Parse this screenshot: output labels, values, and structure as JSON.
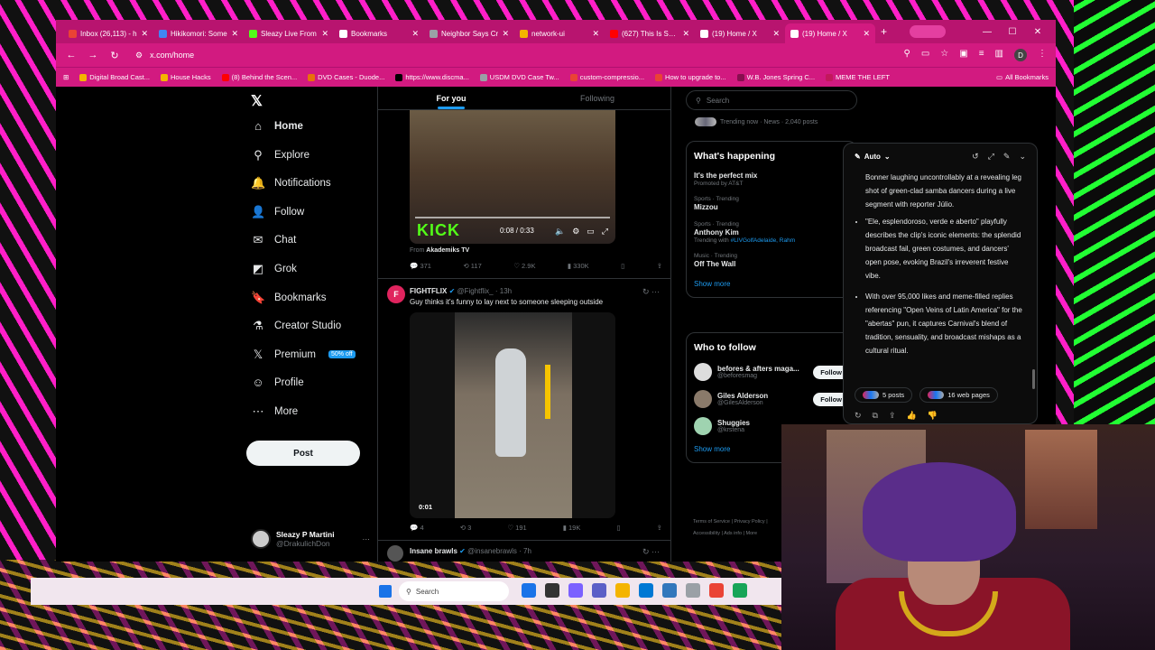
{
  "browser": {
    "tabs": [
      {
        "label": "Inbox (26,113) - h",
        "color": "#ea4335",
        "active": false
      },
      {
        "label": "Hikikomori: Some",
        "color": "#4285f4",
        "active": false
      },
      {
        "label": "Sleazy Live From",
        "color": "#53fc18",
        "active": false
      },
      {
        "label": "Bookmarks",
        "color": "#ffffff",
        "active": false
      },
      {
        "label": "Neighbor Says Cr",
        "color": "#9aa0a6",
        "active": false
      },
      {
        "label": "network-ui",
        "color": "#f4b400",
        "active": false
      },
      {
        "label": "(627) This Is Seric",
        "color": "#ff0000",
        "active": false
      },
      {
        "label": "(19) Home / X",
        "color": "#ffffff",
        "active": false
      },
      {
        "label": "(19) Home / X",
        "color": "#ffffff",
        "active": true
      }
    ],
    "url": "x.com/home",
    "profile_initial": "D",
    "bookmarks": [
      {
        "label": "Digital Broad Cast...",
        "color": "#f4b400"
      },
      {
        "label": "House Hacks",
        "color": "#f4b400"
      },
      {
        "label": "(8) Behind the Scen...",
        "color": "#ff0000"
      },
      {
        "label": "DVD Cases - Duode...",
        "color": "#e8710a"
      },
      {
        "label": "https://www.discma...",
        "color": "#000000"
      },
      {
        "label": "USDM DVD Case Tw...",
        "color": "#9aa0a6"
      },
      {
        "label": "custom-compressio...",
        "color": "#ea4335"
      },
      {
        "label": "How to upgrade to...",
        "color": "#ea4335"
      },
      {
        "label": "W.B. Jones Spring C...",
        "color": "#880e4f"
      },
      {
        "label": "MEME THE LEFT",
        "color": "#c2185b"
      }
    ],
    "all_bookmarks": "All Bookmarks"
  },
  "nav": {
    "items": [
      {
        "label": "Home",
        "icon": "home-icon",
        "glyph": "⌂"
      },
      {
        "label": "Explore",
        "icon": "search-icon",
        "glyph": "⚲"
      },
      {
        "label": "Notifications",
        "icon": "bell-icon",
        "glyph": "🔔"
      },
      {
        "label": "Follow",
        "icon": "person-plus-icon",
        "glyph": "👤"
      },
      {
        "label": "Chat",
        "icon": "mail-icon",
        "glyph": "✉"
      },
      {
        "label": "Grok",
        "icon": "grok-icon",
        "glyph": "◩"
      },
      {
        "label": "Bookmarks",
        "icon": "bookmark-icon",
        "glyph": "🔖"
      },
      {
        "label": "Creator Studio",
        "icon": "flask-icon",
        "glyph": "⚗"
      },
      {
        "label": "Premium",
        "icon": "x-logo-icon",
        "glyph": "𝕏"
      },
      {
        "label": "Profile",
        "icon": "profile-icon",
        "glyph": "☺"
      },
      {
        "label": "More",
        "icon": "more-icon",
        "glyph": "⋯"
      }
    ],
    "premium_badge": "50% off",
    "post_label": "Post",
    "account_name": "Sleazy P Martini",
    "account_handle": "@DrakulichDon"
  },
  "feed": {
    "tab_for_you": "For you",
    "tab_following": "Following",
    "post1": {
      "video_brand": "KICK",
      "video_time": "0:08 / 0:33",
      "from_label": "From",
      "from_source": "Akademiks TV",
      "replies": "371",
      "reposts": "117",
      "likes": "2.9K",
      "views": "330K"
    },
    "post2": {
      "avatar_letter": "F",
      "name": "FIGHTFLIX",
      "handle": "@Fightflix_",
      "time": "· 13h",
      "text": "Guy thinks it's funny to lay next to someone sleeping outside",
      "video_time": "0:01",
      "replies": "4",
      "reposts": "3",
      "likes": "191",
      "views": "19K"
    },
    "post3": {
      "name": "Insane brawls",
      "handle": "@insanebrawls",
      "time": "· 7h"
    }
  },
  "right": {
    "search_placeholder": "Search",
    "top_trend_meta": "Trending now · News · 2,040 posts",
    "whats_happening_title": "What's happening",
    "trends": [
      {
        "meta": "",
        "name": "It's the perfect mix",
        "sub": "Promoted by AT&T",
        "link": ""
      },
      {
        "meta": "Sports · Trending",
        "name": "Mizzou",
        "sub": "",
        "link": ""
      },
      {
        "meta": "Sports · Trending",
        "name": "Anthony Kim",
        "sub": "Trending with ",
        "link": "#LIVGolfAdelaide, Rahm"
      },
      {
        "meta": "Music · Trending",
        "name": "Off The Wall",
        "sub": "",
        "link": ""
      }
    ],
    "show_more": "Show more",
    "who_to_follow_title": "Who to follow",
    "who_to_follow": [
      {
        "name": "befores & afters maga...",
        "handle": "@beforesmag",
        "color": "#dddddd",
        "button": "Follow"
      },
      {
        "name": "Giles Alderson",
        "handle": "@GilesAlderson",
        "color": "#8a7a6a",
        "button": "Follow"
      },
      {
        "name": "Shuggies",
        "handle": "@krstena",
        "color": "#9fd3b0",
        "button": ""
      }
    ],
    "show_more_2": "Show more",
    "footer_line1": "Terms of Service  |  Privacy Policy  |",
    "footer_line2": "Accessibility  |  Ads info  |  More"
  },
  "grok": {
    "mode": "Auto",
    "intro": "Bonner laughing uncontrollably at a revealing leg shot of green-clad samba dancers during a live segment with reporter Júlio.",
    "bullets": [
      "\"Ele, esplendoroso, verde e aberto\" playfully describes the clip's iconic elements: the splendid broadcast fail, green costumes, and dancers' open pose, evoking Brazil's irreverent festive vibe.",
      "With over 95,000 likes and meme-filled replies referencing \"Open Veins of Latin America\" for the \"abertas\" pun, it captures Carnival's blend of tradition, sensuality, and broadcast mishaps as a cultural ritual."
    ],
    "posts_label": "5 posts",
    "web_label": "16 web pages"
  },
  "taskbar": {
    "search_placeholder": "Search",
    "apps": [
      "#1a73e8",
      "#333333",
      "#7b61ff",
      "#5b5fc7",
      "#f4b400",
      "#0078d4",
      "#3277bc",
      "#9aa0a6",
      "#ea4335",
      "#18a558"
    ]
  }
}
